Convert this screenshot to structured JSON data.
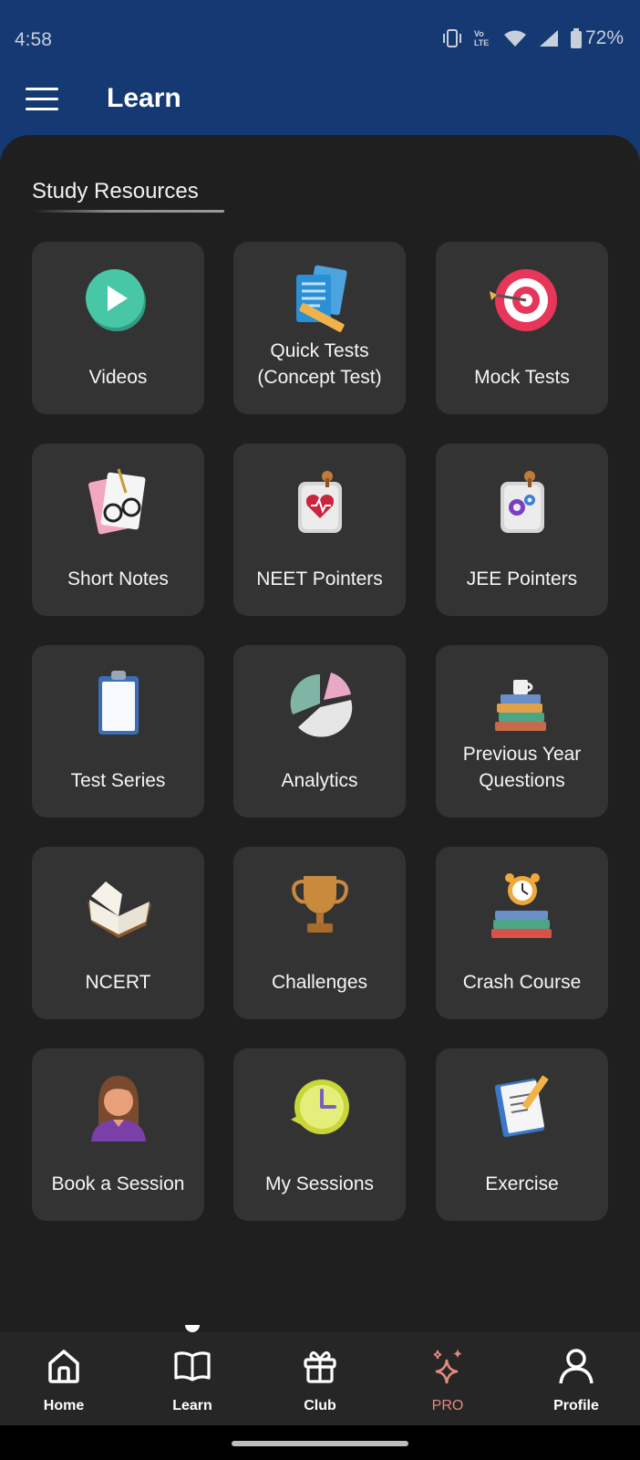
{
  "status": {
    "time": "4:58",
    "battery": "72%",
    "network_label": "Vo LTE"
  },
  "appbar": {
    "title": "Learn"
  },
  "section": {
    "title": "Study Resources"
  },
  "cards": [
    {
      "label": "Videos",
      "icon": "play-icon"
    },
    {
      "label": "Quick Tests\n(Concept Test)",
      "icon": "test-papers-icon"
    },
    {
      "label": "Mock Tests",
      "icon": "target-icon"
    },
    {
      "label": "Short Notes",
      "icon": "notes-glasses-icon"
    },
    {
      "label": "NEET Pointers",
      "icon": "heart-note-icon"
    },
    {
      "label": "JEE Pointers",
      "icon": "gears-note-icon"
    },
    {
      "label": "Test Series",
      "icon": "clipboard-icon"
    },
    {
      "label": "Analytics",
      "icon": "pie-chart-icon"
    },
    {
      "label": "Previous Year\nQuestions",
      "icon": "books-cup-icon"
    },
    {
      "label": "NCERT",
      "icon": "open-book-icon"
    },
    {
      "label": "Challenges",
      "icon": "trophy-icon"
    },
    {
      "label": "Crash Course",
      "icon": "alarm-books-icon"
    },
    {
      "label": "Book a Session",
      "icon": "teacher-avatar-icon"
    },
    {
      "label": "My Sessions",
      "icon": "clock-icon"
    },
    {
      "label": "Exercise",
      "icon": "notepad-pencil-icon"
    }
  ],
  "bottom_nav": [
    {
      "label": "Home",
      "icon": "home-icon"
    },
    {
      "label": "Learn",
      "icon": "book-icon",
      "active": true
    },
    {
      "label": "Club",
      "icon": "gift-icon"
    },
    {
      "label": "PRO",
      "icon": "sparkle-icon"
    },
    {
      "label": "Profile",
      "icon": "profile-icon"
    }
  ],
  "colors": {
    "header": "#153a73",
    "background": "#1f1f1f",
    "card": "#333333",
    "pro_accent": "#e58a7f"
  }
}
